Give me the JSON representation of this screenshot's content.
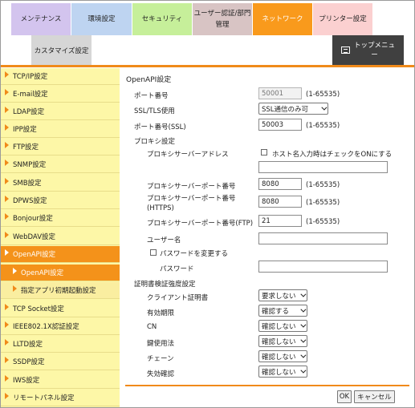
{
  "tabs": {
    "maintenance": "メンテナンス",
    "environment": "環境設定",
    "security": "セキュリティ",
    "auth_line1": "ユーザー認証/部門",
    "auth_line2": "管理",
    "network": "ネットワーク",
    "printer": "プリンター設定",
    "customize": "カスタマイズ設定",
    "top_menu_line1": "トップメニュ",
    "top_menu_line2": "ー"
  },
  "sidebar": {
    "items": [
      "TCP/IP設定",
      "E-mail設定",
      "LDAP設定",
      "IPP設定",
      "FTP設定",
      "SNMP設定",
      "SMB設定",
      "DPWS設定",
      "Bonjour設定",
      "WebDAV設定",
      "OpenAPI設定",
      "OpenAPI設定",
      "指定アプリ初期起動設定",
      "TCP Socket設定",
      "IEEE802.1X認証設定",
      "LLTD設定",
      "SSDP設定",
      "IWS設定",
      "リモートパネル設定"
    ]
  },
  "form": {
    "section_title": "OpenAPI設定",
    "port_label": "ポート番号",
    "port_value": "50001",
    "port_range": "(1-65535)",
    "ssl_label": "SSL/TLS使用",
    "ssl_value": "SSL通信のみ可",
    "ssl_port_label": "ポート番号(SSL)",
    "ssl_port_value": "50003",
    "ssl_port_range": "(1-65535)",
    "proxy_section": "プロキシ設定",
    "proxy_address_label": "プロキシサーバーアドレス",
    "proxy_hostname_check": "ホスト名入力時はチェックをONにする",
    "proxy_address_value": "",
    "proxy_port_label": "プロキシサーバーポート番号",
    "proxy_port_value": "8080",
    "proxy_port_range": "(1-65535)",
    "proxy_https_label1": "プロキシサーバーポート番号",
    "proxy_https_label2": "(HTTPS)",
    "proxy_https_value": "8080",
    "proxy_https_range": "(1-65535)",
    "proxy_ftp_label": "プロキシサーバーポート番号(FTP)",
    "proxy_ftp_value": "21",
    "proxy_ftp_range": "(1-65535)",
    "username_label": "ユーザー名",
    "username_value": "",
    "change_password_check": "パスワードを変更する",
    "password_label": "パスワード",
    "password_value": "",
    "cert_section": "証明書検証強度設定",
    "client_cert_label": "クライアント証明書",
    "client_cert_value": "要求しない",
    "validity_label": "有効期限",
    "validity_value": "確認する",
    "cn_label": "CN",
    "cn_value": "確認しない",
    "key_usage_label": "鍵使用法",
    "key_usage_value": "確認しない",
    "chain_label": "チェーン",
    "chain_value": "確認しない",
    "revocation_label": "失効確認",
    "revocation_value": "確認しない"
  },
  "buttons": {
    "ok": "OK",
    "cancel": "キャンセル"
  }
}
